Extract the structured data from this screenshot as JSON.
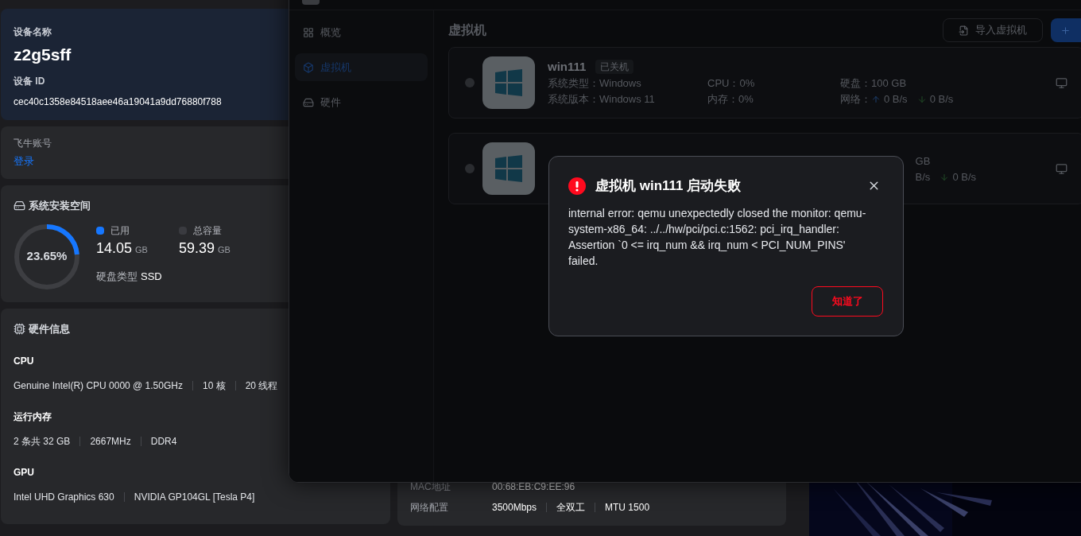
{
  "device": {
    "name_label": "设备名称",
    "name": "z2g5sff",
    "id_label": "设备 ID",
    "id": "cec40c1358e84518aee46a19041a9dd76880f788"
  },
  "account": {
    "label": "飞牛账号",
    "link": "登录"
  },
  "storage": {
    "title": "系统安装空间",
    "percent": "23.65%",
    "level": 0.2365,
    "legend": [
      {
        "label": "已用",
        "value": "14.05",
        "unit": "GB",
        "color": "#1677ff"
      },
      {
        "label": "总容量",
        "value": "59.39",
        "unit": "GB",
        "color": "#3a3b40"
      }
    ],
    "disk_type_label": "硬盘类型",
    "disk_type": "SSD"
  },
  "hardware": {
    "title": "硬件信息",
    "sections": [
      {
        "heading": "CPU",
        "values": [
          "Genuine Intel(R) CPU 0000 @ 1.50GHz",
          "10 核",
          "20 线程"
        ]
      },
      {
        "heading": "运行内存",
        "values": [
          "2 条共 32 GB",
          "2667MHz",
          "DDR4"
        ]
      },
      {
        "heading": "GPU",
        "values": [
          "Intel UHD Graphics 630",
          "NVIDIA GP104GL [Tesla P4]"
        ]
      }
    ]
  },
  "network": {
    "rows": [
      {
        "label": "MAC地址",
        "values": [
          "00:68:EB:C9:EE:96"
        ],
        "dimmed": true
      },
      {
        "label": "网络配置",
        "values": [
          "3500Mbps",
          "全双工",
          "MTU 1500"
        ],
        "dimmed": false
      }
    ]
  },
  "vm_window": {
    "sidebar": [
      {
        "label": "概览",
        "selected": false
      },
      {
        "label": "虚拟机",
        "selected": true
      },
      {
        "label": "硬件",
        "selected": false
      }
    ],
    "title": "虚拟机",
    "buttons": [
      {
        "kind": "import",
        "label": "导入虚拟机"
      },
      {
        "kind": "add"
      }
    ],
    "vms": [
      {
        "kind": "full",
        "running": false,
        "name": "win111",
        "status": "已关机",
        "type": "系统类型：Windows",
        "version": "系统版本：Windows 11",
        "cpu": "CPU：0%",
        "memory": "内存：0%",
        "disk": "硬盘：100 GB",
        "net_label": "网络：",
        "net_up": "0 B/s",
        "net_down": "0 B/s"
      },
      {
        "kind": "partial",
        "running": false,
        "disk": "GB",
        "net_up": "B/s",
        "net_down": "0 B/s"
      }
    ]
  },
  "dialog": {
    "title": "虚拟机 win111 启动失败",
    "message": "internal error: qemu unexpectedly closed the monitor: qemu-system-x86_64: ../../hw/pci/pci.c:1562: pci_irq_handler: Assertion `0 <= irq_num && irq_num < PCI_NUM_PINS' failed.",
    "button": "知道了"
  }
}
